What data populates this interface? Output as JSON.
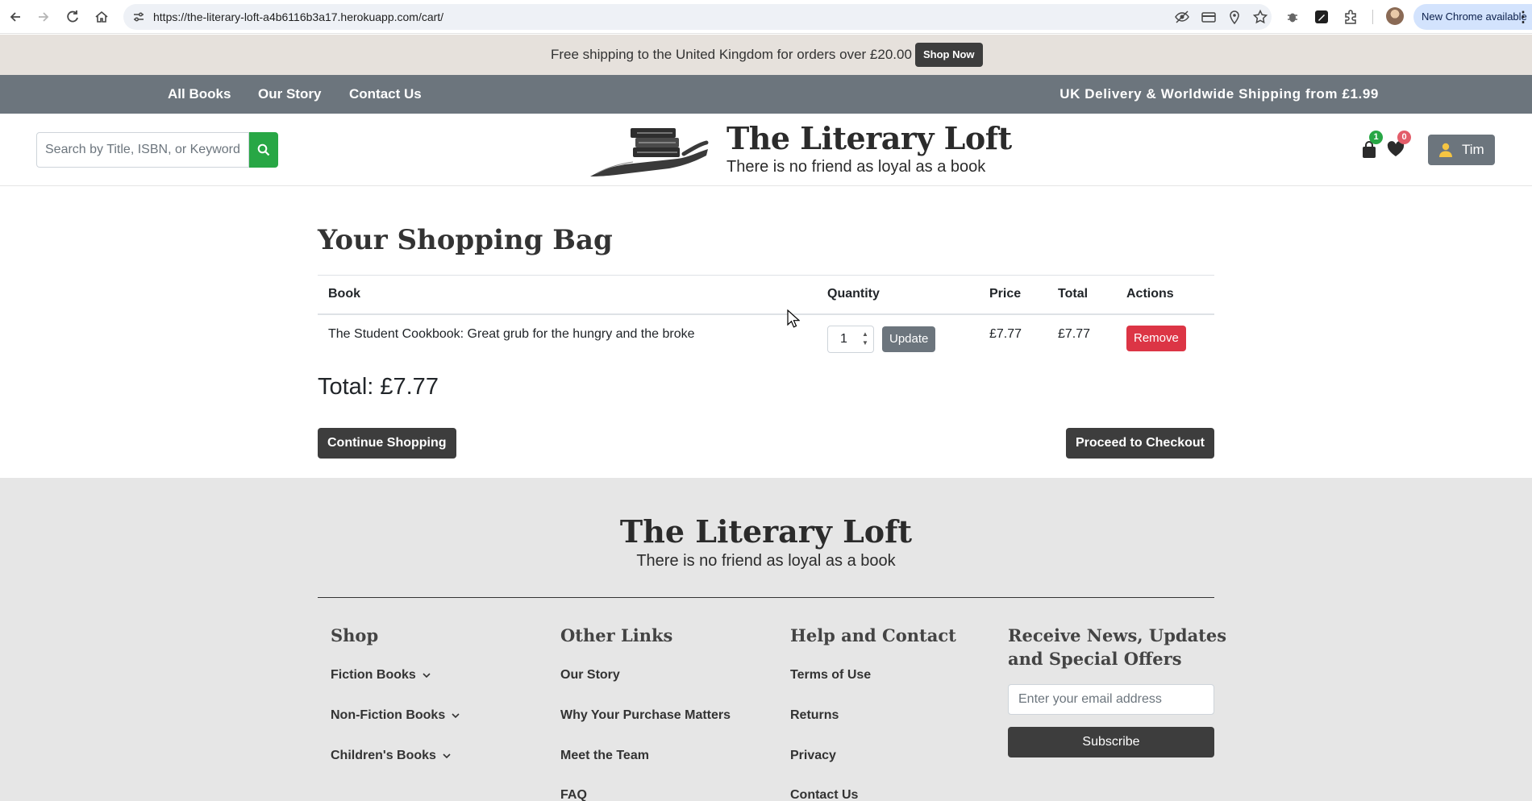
{
  "browser": {
    "url": "https://the-literary-loft-a4b6116b3a17.herokuapp.com/cart/",
    "update_chip": "New Chrome available"
  },
  "announcement": {
    "message": "Free shipping to the United Kingdom for orders over £20.00",
    "button": "Shop Now"
  },
  "nav": {
    "links": [
      "All Books",
      "Our Story",
      "Contact Us"
    ],
    "shipping_note": "UK Delivery & Worldwide Shipping from £1.99"
  },
  "header": {
    "search_placeholder": "Search by Title, ISBN, or Keyword",
    "brand": "The Literary Loft",
    "tagline": "There is no friend as loyal as a book",
    "cart_count": "1",
    "wishlist_count": "0",
    "user_name": "Tim"
  },
  "cart": {
    "title": "Your Shopping Bag",
    "columns": [
      "Book",
      "Quantity",
      "Price",
      "Total",
      "Actions"
    ],
    "items": [
      {
        "book": "The Student Cookbook: Great grub for the hungry and the broke",
        "quantity": "1",
        "price": "£7.77",
        "total": "£7.77",
        "update_label": "Update",
        "remove_label": "Remove"
      }
    ],
    "grand_total": "Total: £7.77",
    "continue_label": "Continue Shopping",
    "checkout_label": "Proceed to Checkout"
  },
  "footer": {
    "brand": "The Literary Loft",
    "tagline": "There is no friend as loyal as a book",
    "shop": {
      "heading": "Shop",
      "links": [
        "Fiction Books",
        "Non-Fiction Books",
        "Children's Books"
      ]
    },
    "other": {
      "heading": "Other Links",
      "links": [
        "Our Story",
        "Why Your Purchase Matters",
        "Meet the Team",
        "FAQ"
      ]
    },
    "help": {
      "heading": "Help and Contact",
      "links": [
        "Terms of Use",
        "Returns",
        "Privacy",
        "Contact Us"
      ]
    },
    "newsletter": {
      "heading_line1": "Receive News, Updates",
      "heading_line2": "and Special Offers",
      "email_placeholder": "Enter your email address",
      "subscribe_label": "Subscribe"
    }
  },
  "colors": {
    "nav_bg": "#6c757d",
    "announce_bg": "#e6e1dc",
    "search_green": "#28a745",
    "remove_red": "#dc3545",
    "dark_button": "#3d3d3d",
    "footer_bg": "#e6e6e6"
  }
}
